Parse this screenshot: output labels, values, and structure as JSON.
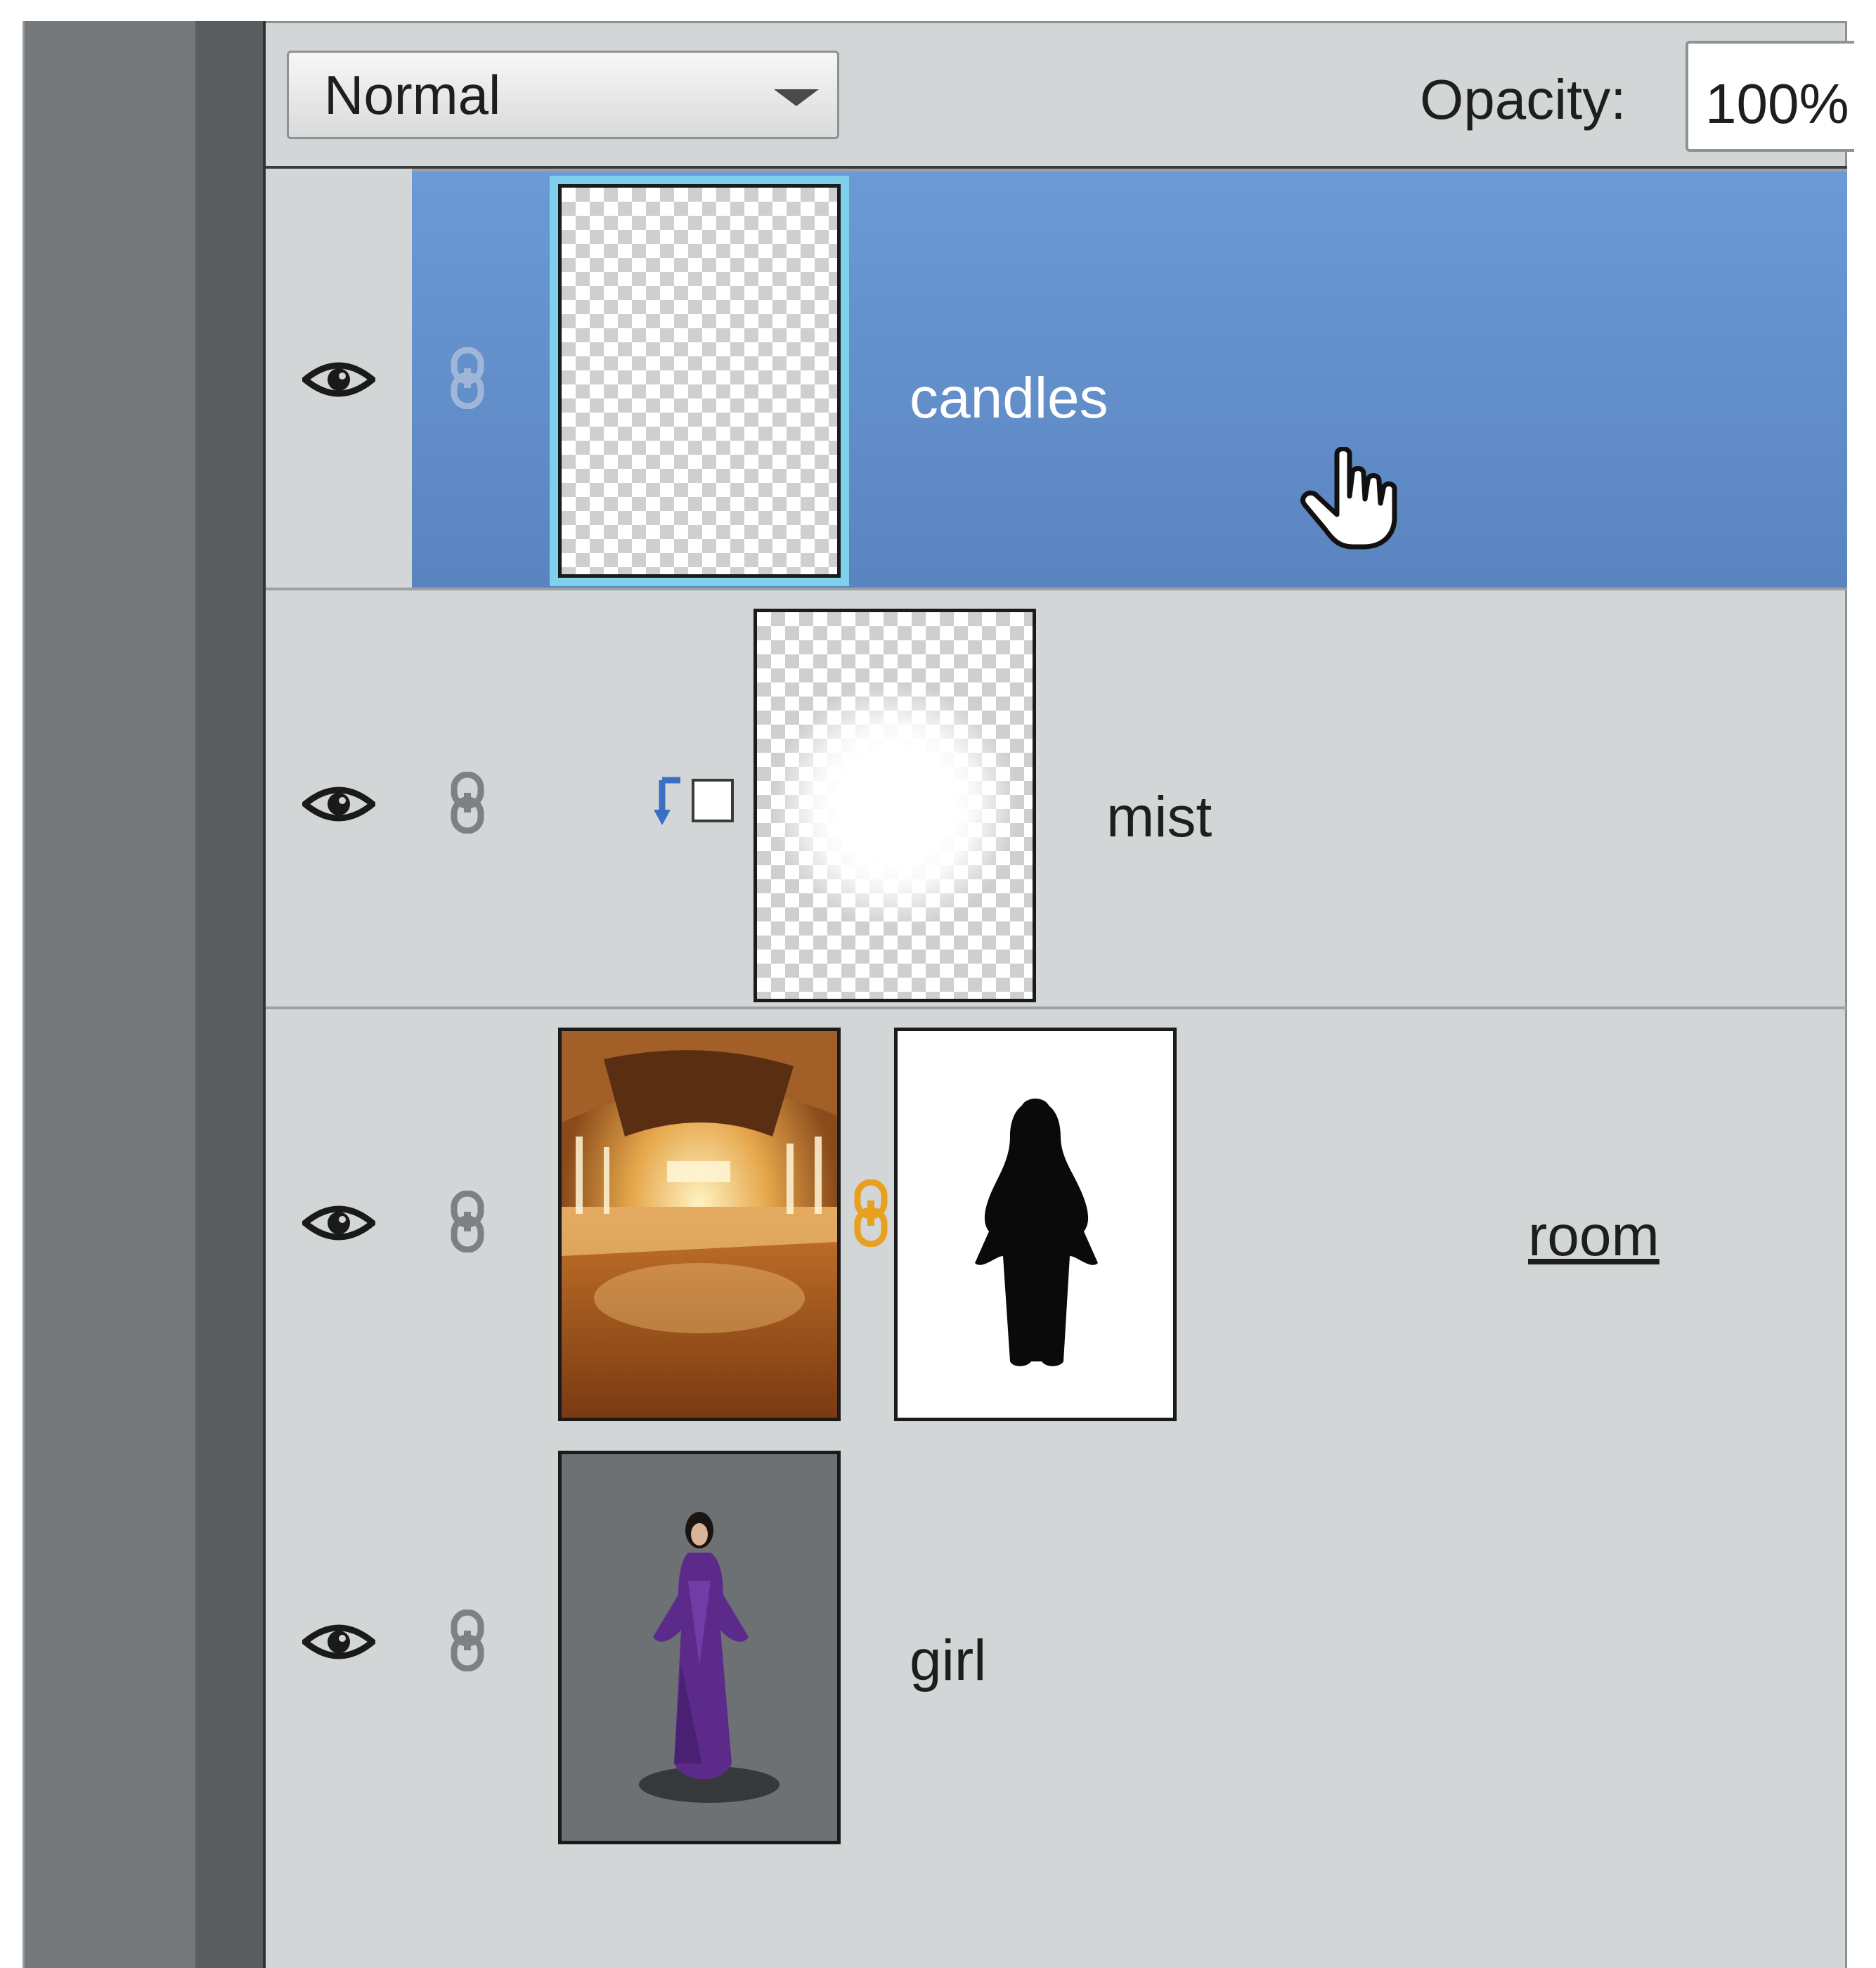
{
  "toolbar": {
    "blend_mode": "Normal",
    "opacity_label": "Opacity:",
    "opacity_value": "100%"
  },
  "layers": [
    {
      "name": "candles",
      "visible": true,
      "selected": true,
      "thumbnail": "transparent"
    },
    {
      "name": "mist",
      "visible": true,
      "clipped": true,
      "thumbnail": "white soft glow on transparent"
    },
    {
      "name": "room",
      "visible": true,
      "has_mask": true,
      "mask_linked": true,
      "thumbnail": "golden ballroom",
      "mask": "black figure silhouette"
    },
    {
      "name": "girl",
      "visible": true,
      "thumbnail": "woman in purple dress"
    }
  ],
  "colors": {
    "panel_bg": "#d3d6d7",
    "selection_blue": "#6390cc",
    "mask_link_orange": "#e8a020"
  }
}
